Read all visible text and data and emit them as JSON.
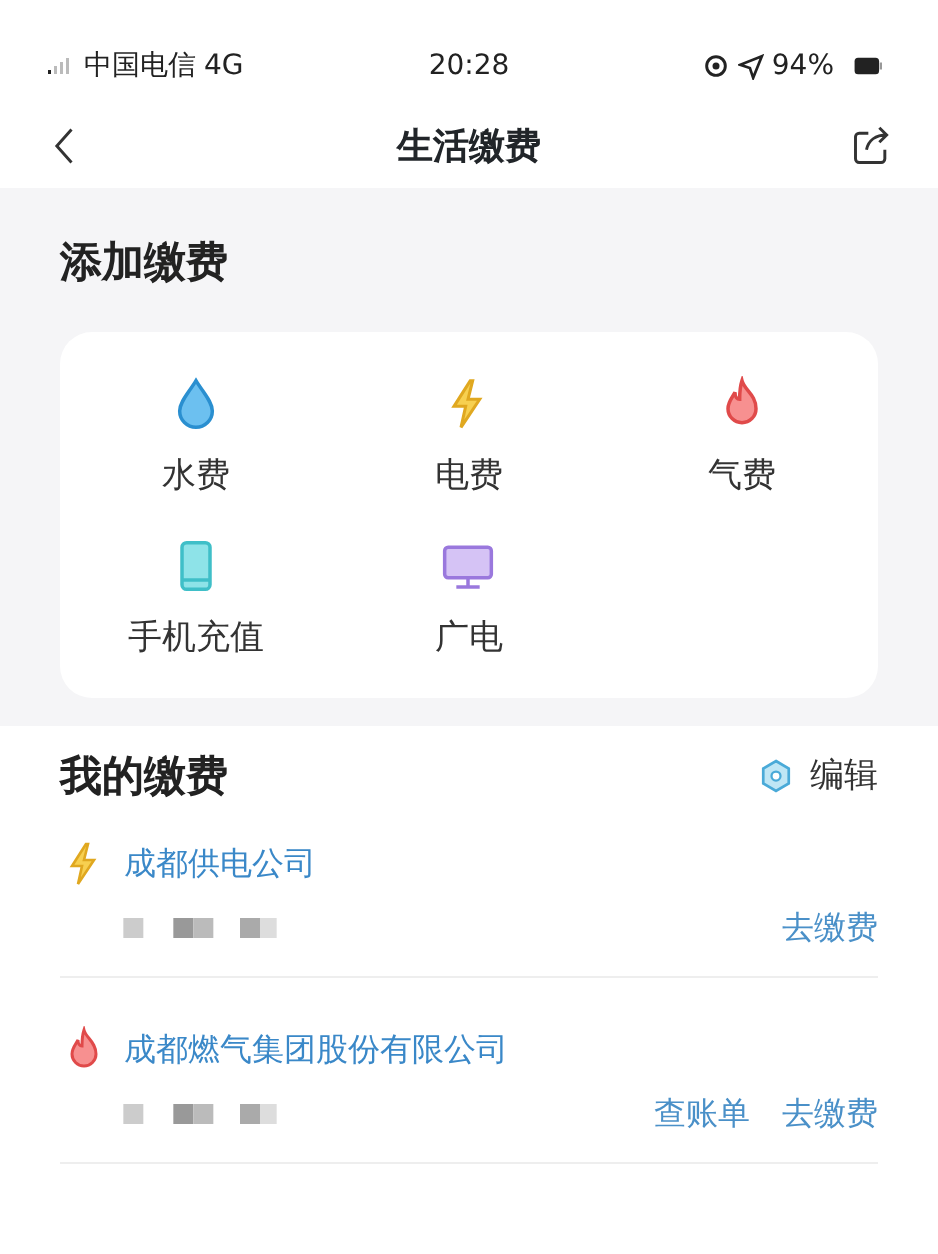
{
  "status_bar": {
    "carrier": "中国电信",
    "network": "4G",
    "time": "20:28",
    "battery": "94%"
  },
  "nav": {
    "title": "生活缴费"
  },
  "add_section": {
    "title": "添加缴费",
    "items": [
      {
        "label": "水费",
        "kind": "water"
      },
      {
        "label": "电费",
        "kind": "electric"
      },
      {
        "label": "气费",
        "kind": "gas"
      },
      {
        "label": "手机充值",
        "kind": "phone"
      },
      {
        "label": "广电",
        "kind": "tv"
      }
    ]
  },
  "my_section": {
    "title": "我的缴费",
    "edit": "编辑",
    "bills": [
      {
        "name": "成都供电公司",
        "kind": "electric",
        "actions": [
          "去缴费"
        ]
      },
      {
        "name": "成都燃气集团股份有限公司",
        "kind": "gas",
        "actions": [
          "查账单",
          "去缴费"
        ]
      }
    ]
  }
}
